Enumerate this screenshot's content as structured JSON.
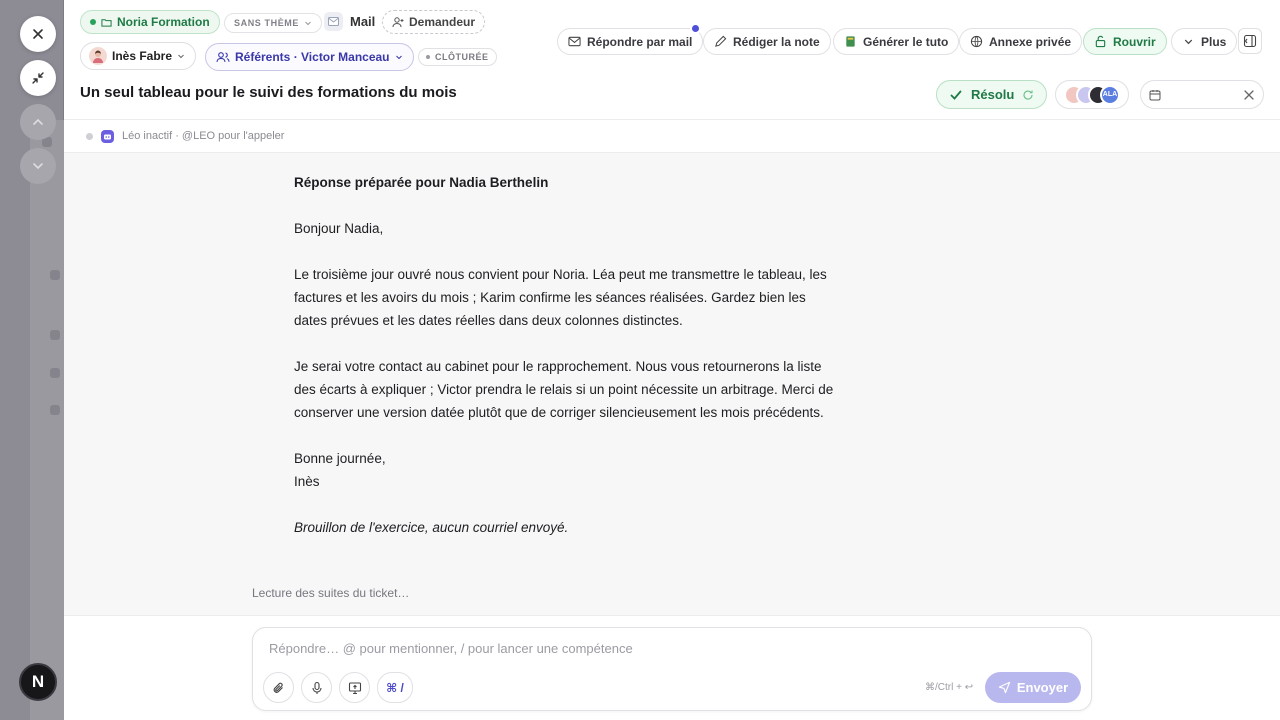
{
  "header": {
    "company": "Noria Formation",
    "theme": "SANS THÈME",
    "channel": "Mail",
    "requester": "Demandeur",
    "assignee": "Inès Fabre",
    "referents": "Référents · Victor Manceau",
    "status_tag": "CLÔTURÉE",
    "title": "Un seul tableau pour le suivi des formations du mois",
    "resolved_label": "Résolu",
    "avatar_initials": "ALA"
  },
  "actions": {
    "reply_mail": "Répondre par mail",
    "write_note": "Rédiger la note",
    "generate_tuto": "Générer le tuto",
    "private_annex": "Annexe privée",
    "reopen": "Rouvrir",
    "more": "Plus"
  },
  "agent": {
    "status": "Léo inactif · @LEO pour l'appeler"
  },
  "letter": {
    "heading": "Réponse préparée pour Nadia Berthelin",
    "greeting": "Bonjour Nadia,",
    "paragraph1": "Le troisième jour ouvré nous convient pour Noria. Léa peut me transmettre le tableau, les factures et les avoirs du mois ; Karim confirme les séances réalisées. Gardez bien les dates prévues et les dates réelles dans deux colonnes distinctes.",
    "paragraph2": "Je serai votre contact au cabinet pour le rapprochement. Nous vous retournerons la liste des écarts à expliquer ; Victor prendra le relais si un point nécessite un arbitrage. Merci de conserver une version datée plutôt que de corriger silencieusement les mois précédents.",
    "closing": "Bonne journée,",
    "signature": "Inès",
    "note": "Brouillon de l'exercice, aucun courriel envoyé."
  },
  "loading_text": "Lecture des suites du ticket…",
  "composer": {
    "placeholder": "Répondre… @ pour mentionner, / pour lancer une compétence",
    "command_label": "⌘ /",
    "shortcut": "⌘/Ctrl + ↩",
    "send_label": "Envoyer"
  },
  "rail": {
    "badge": "N"
  },
  "colors": {
    "accent": "#4f4fd8",
    "success": "#1f7a45",
    "send_disabled": "#b9b8ee"
  }
}
